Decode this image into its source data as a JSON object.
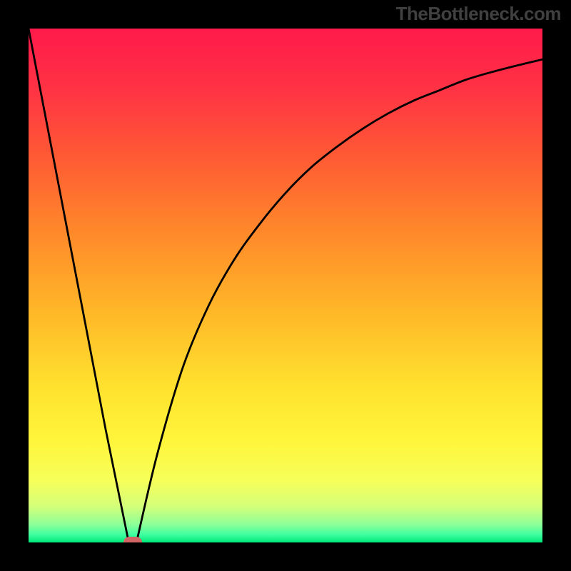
{
  "watermark": "TheBottleneck.com",
  "chart_data": {
    "type": "line",
    "title": "",
    "xlabel": "",
    "ylabel": "",
    "xlim": [
      0,
      100
    ],
    "ylim": [
      0,
      100
    ],
    "grid": false,
    "legend": false,
    "series": [
      {
        "name": "left-branch",
        "x": [
          0,
          5,
          10,
          15,
          19.5
        ],
        "values": [
          100,
          74,
          48,
          22,
          0
        ]
      },
      {
        "name": "right-branch",
        "x": [
          21,
          25,
          30,
          35,
          40,
          45,
          50,
          55,
          60,
          65,
          70,
          75,
          80,
          85,
          90,
          95,
          100
        ],
        "values": [
          0,
          17,
          34,
          46,
          55,
          62,
          68,
          73,
          77,
          80.5,
          83.5,
          86,
          88,
          90,
          91.5,
          92.8,
          94
        ]
      }
    ],
    "marker": {
      "x": 20.3,
      "y": 0
    },
    "gradient_stops": [
      {
        "pos": 0.0,
        "color": "#ff1a4b"
      },
      {
        "pos": 0.12,
        "color": "#ff3344"
      },
      {
        "pos": 0.25,
        "color": "#ff5a34"
      },
      {
        "pos": 0.4,
        "color": "#ff8a2a"
      },
      {
        "pos": 0.55,
        "color": "#ffb728"
      },
      {
        "pos": 0.7,
        "color": "#ffe22e"
      },
      {
        "pos": 0.8,
        "color": "#fff53a"
      },
      {
        "pos": 0.88,
        "color": "#f6ff5a"
      },
      {
        "pos": 0.93,
        "color": "#d4ff7a"
      },
      {
        "pos": 0.965,
        "color": "#8cff98"
      },
      {
        "pos": 0.985,
        "color": "#3effa0"
      },
      {
        "pos": 1.0,
        "color": "#00e878"
      }
    ]
  }
}
